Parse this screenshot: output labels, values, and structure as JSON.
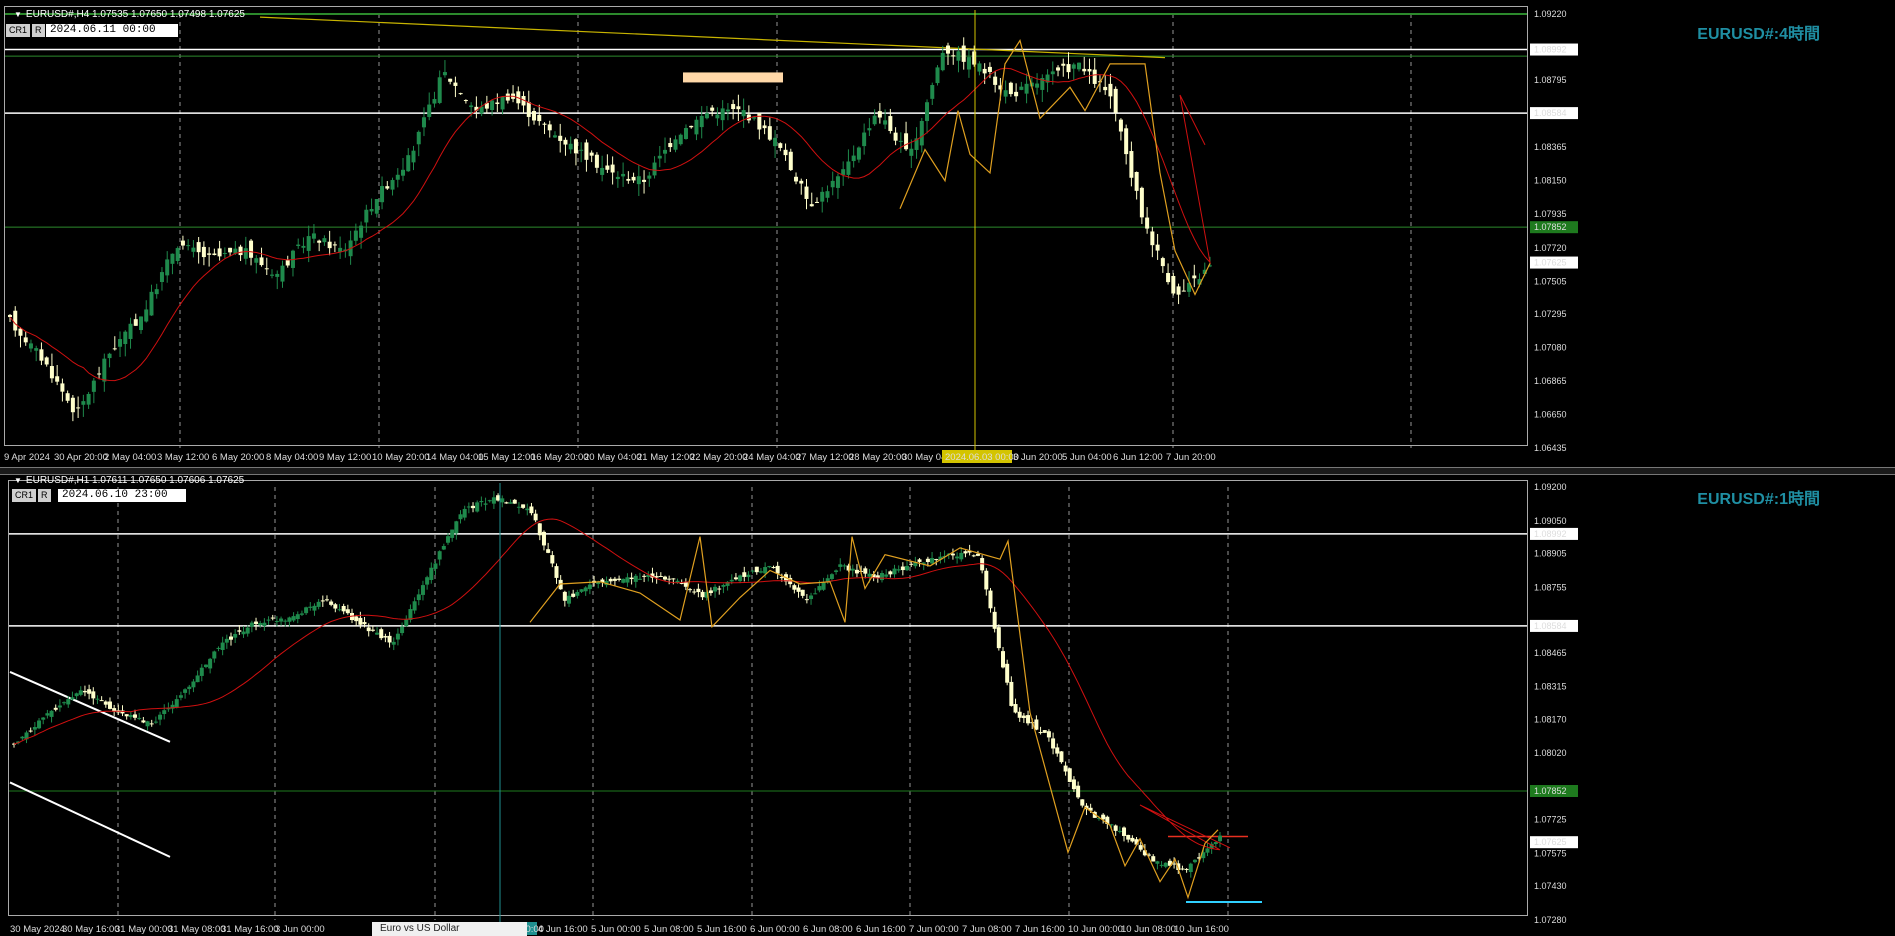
{
  "top_panel": {
    "info": "EURUSD#,H4  1.07535 1.07650 1.07498 1.07625",
    "badges": [
      "CR1",
      "R"
    ],
    "datetime": "2024.06.11 00:00",
    "title": "EURUSD#:4時間",
    "y_ticks": [
      "1.09220",
      "1.08992",
      "1.08795",
      "1.08584",
      "1.08365",
      "1.08150",
      "1.07935",
      "1.07852",
      "1.07720",
      "1.07625",
      "1.07505",
      "1.07295",
      "1.07080",
      "1.06865",
      "1.06650",
      "1.06435"
    ],
    "x_labels": [
      "9 Apr 2024",
      "30 Apr 20:00",
      "2 May 04:00",
      "3 May 12:00",
      "6 May 20:00",
      "8 May 04:00",
      "9 May 12:00",
      "10 May 20:00",
      "14 May 04:00",
      "15 May 12:00",
      "16 May 20:00",
      "20 May 04:00",
      "21 May 12:00",
      "22 May 20:00",
      "24 May 04:00",
      "27 May 12:00",
      "28 May 20:00",
      "30 May 04:00",
      "3 Jun 20:00",
      "5 Jun 04:00",
      "6 Jun 12:00",
      "7 Jun 20:00"
    ],
    "crosshair_date": "2024.06.03 00:00"
  },
  "bottom_panel": {
    "info": "EURUSD#,H1  1.07611 1.07650 1.07606 1.07625",
    "badges": [
      "CR1",
      "R"
    ],
    "datetime": "2024.06.10 23:00",
    "title": "EURUSD#:1時間",
    "y_ticks": [
      "1.09200",
      "1.09050",
      "1.08992",
      "1.08905",
      "1.08755",
      "1.08584",
      "1.08465",
      "1.08315",
      "1.08170",
      "1.08020",
      "1.07852",
      "1.07725",
      "1.07625",
      "1.07575",
      "1.07430",
      "1.07280"
    ],
    "x_labels": [
      "30 May 2024",
      "30 May 16:00",
      "31 May 00:00",
      "31 May 08:00",
      "31 May 16:00",
      "3 Jun 00:00",
      "Jun 00:00",
      "4 Jun 16:00",
      "5 Jun 00:00",
      "5 Jun 08:00",
      "5 Jun 16:00",
      "6 Jun 00:00",
      "6 Jun 08:00",
      "6 Jun 16:00",
      "7 Jun 00:00",
      "7 Jun 08:00",
      "7 Jun 16:00",
      "10 Jun 00:00",
      "10 Jun 08:00",
      "10 Jun 16:00"
    ],
    "crosshair_date": "2024.06.04 10:00"
  },
  "tab_label": "Euro vs US Dollar",
  "colors": {
    "background": "#000000",
    "bull_candle": "#1f8a4c",
    "bear_candle": "#ffffcc",
    "ma_line": "#d01010",
    "zigzag": "#e0a020",
    "level_line": "#ffffff",
    "green_line": "#1e7a1e",
    "title": "#1f8fa3",
    "crosshair_top": "#d4c400",
    "crosshair_bottom": "#1f8f8f"
  }
}
